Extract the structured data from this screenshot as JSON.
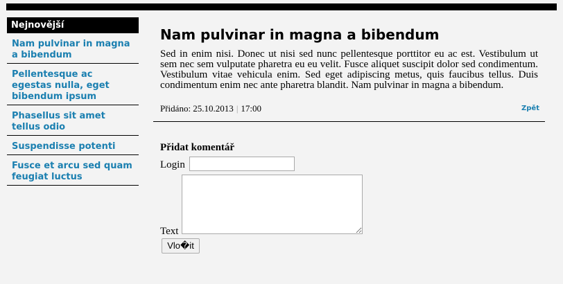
{
  "sidebar": {
    "heading": "Nejnovější",
    "items": [
      {
        "label": "Nam pulvinar in magna a bibendum"
      },
      {
        "label": "Pellentesque ac egestas nulla, eget bibendum ipsum"
      },
      {
        "label": "Phasellus sit amet tellus odio"
      },
      {
        "label": "Suspendisse potenti"
      },
      {
        "label": "Fusce et arcu sed quam feugiat luctus"
      }
    ]
  },
  "article": {
    "title": "Nam pulvinar in magna a bibendum",
    "body": "Sed in enim nisi. Donec ut nisi sed nunc pellentesque porttitor eu ac est. Vestibulum ut sem nec sem vulputate pharetra eu eu velit. Fusce aliquet suscipit dolor sed condimentum. Vestibulum vitae vehicula enim. Sed eget adipiscing metus, quis faucibus tellus. Duis condimentum enim nec ante pharetra blandit. Nam pulvinar in magna a bibendum.",
    "added_label": "Přidáno: 25.10.2013",
    "time": "17:00",
    "back_link": "Zpět"
  },
  "comment_form": {
    "heading": "Přidat komentář",
    "login_label": "Login",
    "login_value": "",
    "text_label": "Text",
    "text_value": "",
    "submit_label": "Vlo�it"
  },
  "colors": {
    "link": "#1a7fb0",
    "background": "#f3f3f3",
    "bar": "#000000"
  }
}
